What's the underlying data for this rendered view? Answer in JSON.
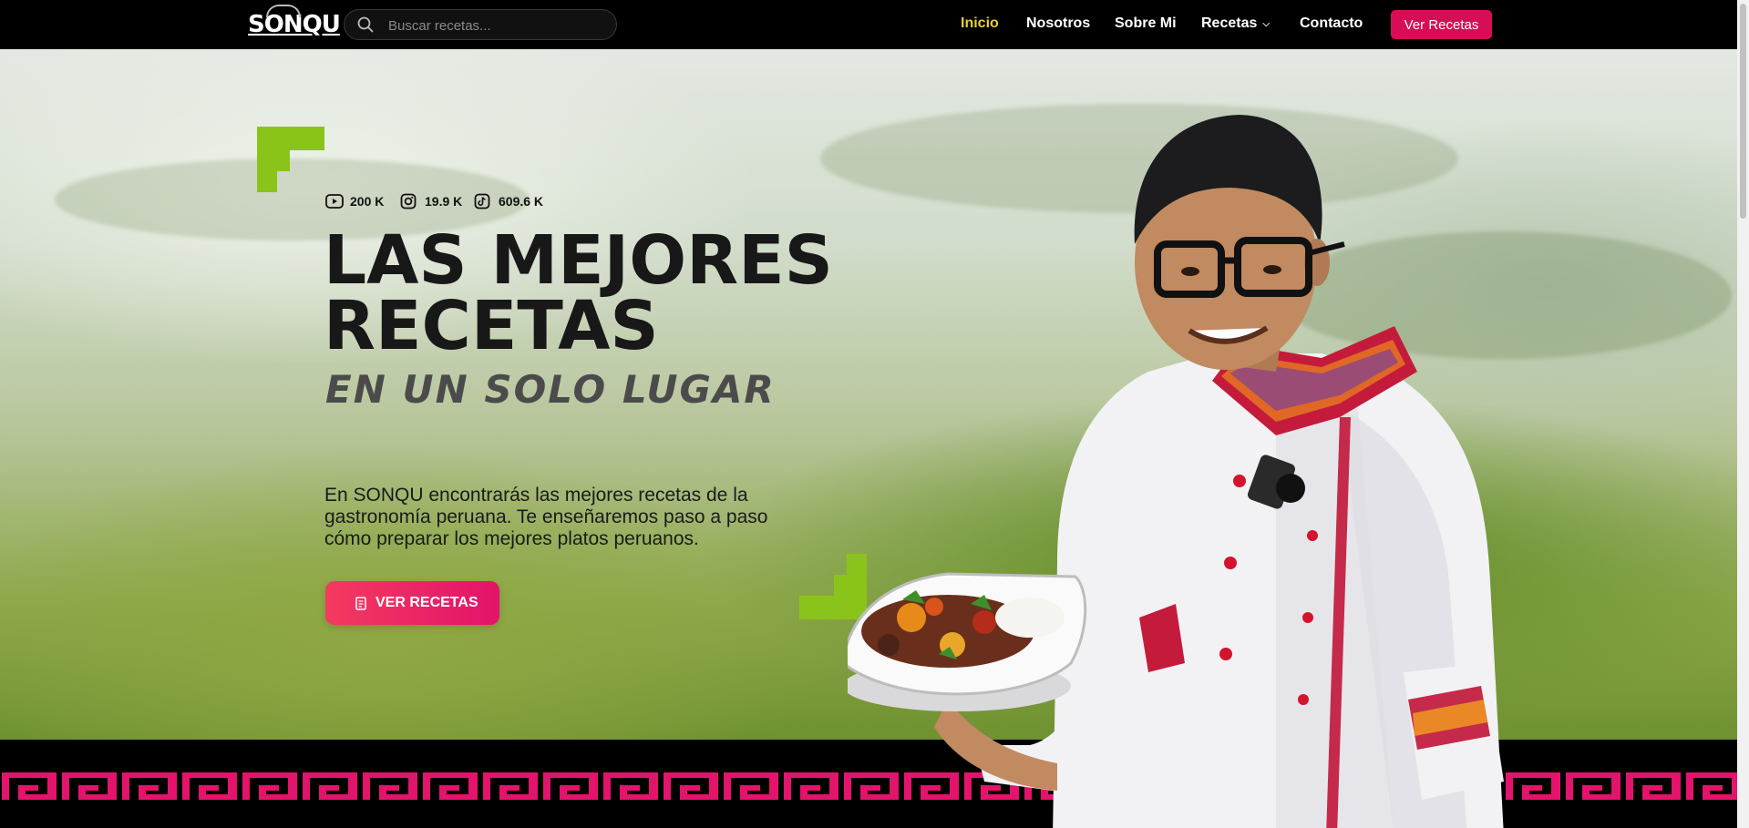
{
  "nav": {
    "logo": "SONQU",
    "search_placeholder": "Buscar recetas...",
    "items": [
      {
        "label": "Inicio",
        "active": true
      },
      {
        "label": "Nosotros",
        "active": false
      },
      {
        "label": "Sobre Mi",
        "active": false
      },
      {
        "label": "Recetas",
        "active": false,
        "has_dropdown": true
      },
      {
        "label": "Contacto",
        "active": false
      }
    ],
    "cta_label": "Ver Recetas"
  },
  "hero": {
    "stats": [
      {
        "icon": "youtube-icon",
        "value": "200 K"
      },
      {
        "icon": "instagram-icon",
        "value": "19.9 K"
      },
      {
        "icon": "tiktok-icon",
        "value": "609.6 K"
      }
    ],
    "title_line1": "LAS MEJORES",
    "title_line2": "RECETAS",
    "subtitle": "EN UN SOLO LUGAR",
    "description": "En SONQU encontrarás las mejores recetas de la gastronomía peruana. Te enseñaremos paso a paso cómo preparar los mejores platos peruanos.",
    "button_label": "VER RECETAS"
  },
  "colors": {
    "accent_pink": "#d90d55",
    "active_yellow": "#e8cc3a",
    "deco_green": "#8ac41b",
    "pattern_pink": "#e4136b"
  }
}
